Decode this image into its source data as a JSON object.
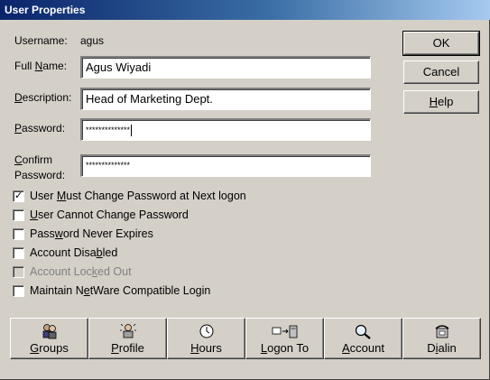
{
  "window": {
    "title": "User Properties"
  },
  "fields": {
    "username_label": "Username:",
    "username_value": "agus",
    "fullname_label": "Full Name:",
    "fullname_value": "Agus Wiyadi",
    "description_label": "Description:",
    "description_value": "Head of Marketing Dept.",
    "password_label": "Password:",
    "password_value": "**************",
    "confirm_label_line1": "Confirm",
    "confirm_label_line2": "Password:",
    "confirm_value": "**************"
  },
  "side_buttons": {
    "ok": "OK",
    "cancel": "Cancel",
    "help": "Help"
  },
  "checkboxes": [
    {
      "label": "User Must Change Password at Next logon",
      "checked": true,
      "enabled": true
    },
    {
      "label": "User Cannot Change Password",
      "checked": false,
      "enabled": true
    },
    {
      "label": "Password Never Expires",
      "checked": false,
      "enabled": true
    },
    {
      "label": "Account Disabled",
      "checked": false,
      "enabled": true
    },
    {
      "label": "Account Locked Out",
      "checked": false,
      "enabled": false
    },
    {
      "label": "Maintain NetWare Compatible Login",
      "checked": false,
      "enabled": true
    }
  ],
  "bottom_buttons": [
    {
      "label": "Groups",
      "icon": "groups-icon"
    },
    {
      "label": "Profile",
      "icon": "profile-icon"
    },
    {
      "label": "Hours",
      "icon": "clock-icon"
    },
    {
      "label": "Logon To",
      "icon": "logon-to-icon"
    },
    {
      "label": "Account",
      "icon": "account-icon"
    },
    {
      "label": "Dialin",
      "icon": "dialin-icon"
    }
  ]
}
